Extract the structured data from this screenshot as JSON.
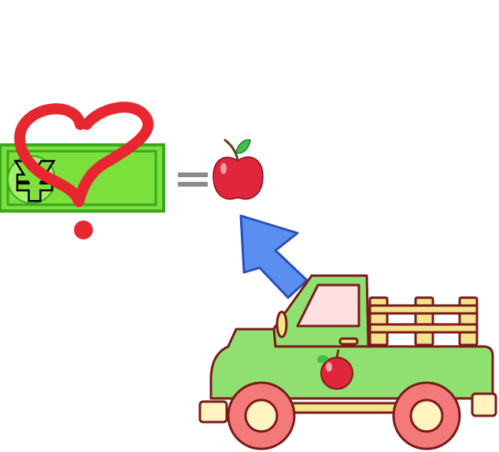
{
  "banknote": {
    "symbol": "¥",
    "color": "#7be03c",
    "border_color": "#3aa81e",
    "symbol_color": "#000000"
  },
  "question_mark": {
    "color": "#e8262f",
    "text": "?"
  },
  "equals": {
    "symbol": "=",
    "color": "#8a8a8a"
  },
  "apple": {
    "body_color": "#e0263a",
    "leaf_color": "#3fbf4a",
    "icon": "apple-icon"
  },
  "arrow": {
    "color": "#5a8ef0",
    "border_color": "#2a4fb8",
    "icon": "arrow-up-left-icon"
  },
  "truck": {
    "body_color": "#8fe070",
    "outline_color": "#7a1a1a",
    "cabin_window_color": "#ffe0e0",
    "fence_color": "#f2e48a",
    "wheel_color": "#f47a7a",
    "hub_color": "#fff3c0",
    "apple_emblem_color": "#e0263a",
    "icon": "pickup-truck-icon"
  }
}
